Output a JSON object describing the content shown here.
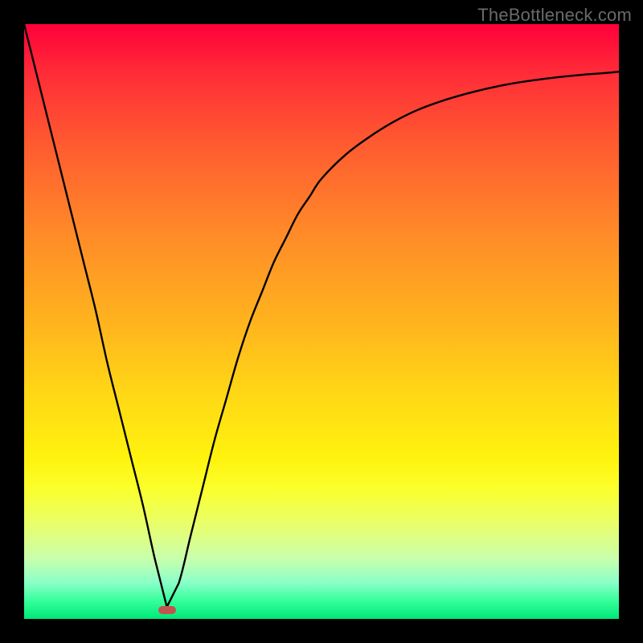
{
  "watermark": "TheBottleneck.com",
  "colors": {
    "background": "#000000",
    "curve_stroke": "#000000",
    "marker": "#c25450"
  },
  "chart_data": {
    "type": "line",
    "title": "",
    "xlabel": "",
    "ylabel": "",
    "xlim": [
      0,
      100
    ],
    "ylim": [
      0,
      100
    ],
    "min_point": {
      "x": 24,
      "y": 1.5
    },
    "series": [
      {
        "name": "curve",
        "x": [
          0,
          2,
          4,
          6,
          8,
          10,
          12,
          14,
          16,
          18,
          20,
          22,
          24,
          26,
          28,
          30,
          32,
          34,
          36,
          38,
          40,
          42,
          44,
          46,
          48,
          50,
          54,
          58,
          62,
          66,
          70,
          74,
          78,
          82,
          86,
          90,
          94,
          98,
          100
        ],
        "values": [
          100,
          92,
          84,
          76,
          68,
          60,
          52,
          43,
          35,
          27,
          19,
          10,
          2,
          6,
          14,
          22,
          30,
          37,
          44,
          50,
          55,
          60,
          64,
          68,
          71,
          74,
          78,
          81,
          83.5,
          85.5,
          87,
          88.2,
          89.2,
          90,
          90.6,
          91.1,
          91.5,
          91.8,
          92
        ]
      }
    ]
  }
}
